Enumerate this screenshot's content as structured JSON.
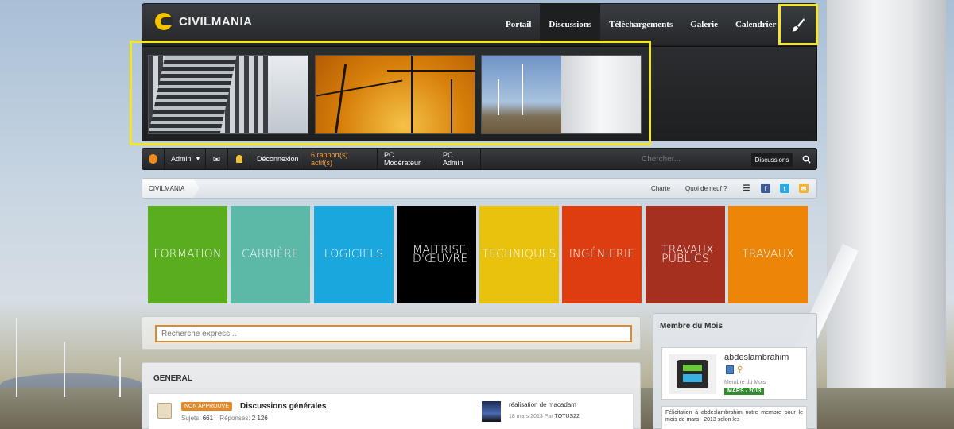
{
  "site": {
    "name": "CIVILMANIA"
  },
  "nav": {
    "items": [
      {
        "label": "Portail",
        "active": false
      },
      {
        "label": "Discussions",
        "active": true
      },
      {
        "label": "Téléchargements",
        "active": false
      },
      {
        "label": "Galerie",
        "active": false
      },
      {
        "label": "Calendrier",
        "active": false
      }
    ],
    "style_icon": "brush-icon"
  },
  "userbar": {
    "admin_label": "Admin",
    "logout": "Déconnexion",
    "reports": "6 rapport(s) actif(s)",
    "moderator_panel": "PC Modérateur",
    "admin_panel": "PC Admin",
    "search_placeholder": "Chercher...",
    "search_scope": "Discussions"
  },
  "breadcrumb": {
    "root": "CIVILMANIA",
    "links": [
      "Charte",
      "Quoi de neuf ?"
    ]
  },
  "tiles": [
    {
      "label": "FORMATION",
      "color": "#5aad1e"
    },
    {
      "label": "CARRIÈRE",
      "color": "#5cb8a7"
    },
    {
      "label": "LOGICIELS",
      "color": "#1aa7de"
    },
    {
      "label": "MAITRISE D'ŒUVRE",
      "color": "#000000"
    },
    {
      "label": "TECHNIQUES",
      "color": "#e8c20c"
    },
    {
      "label": "INGÉNIERIE",
      "color": "#de3e0f"
    },
    {
      "label": "TRAVAUX PUBLICS",
      "color": "#a5301f"
    },
    {
      "label": "TRAVAUX",
      "color": "#ec8508"
    }
  ],
  "express_search": {
    "placeholder": "Recherche express .."
  },
  "forum": {
    "section": "GENERAL",
    "rows": [
      {
        "badge": "NON APPROUVE",
        "title": "Discussions générales",
        "subjects_label": "Sujets:",
        "subjects": "661",
        "replies_label": "Réponses:",
        "replies": "2 126",
        "last_post": "réalisation de macadam",
        "last_date": "18 mars 2013",
        "by_label": "Par",
        "last_author": "TOTUS22"
      }
    ]
  },
  "member_of_month": {
    "title": "Membre du Mois",
    "username": "abdeslambrahim",
    "role": "Membre du Mois",
    "date": "MARS - 2013",
    "text": "Félicitation à abdeslambrahim notre membre pour le mois de mars - 2013 selon les"
  }
}
